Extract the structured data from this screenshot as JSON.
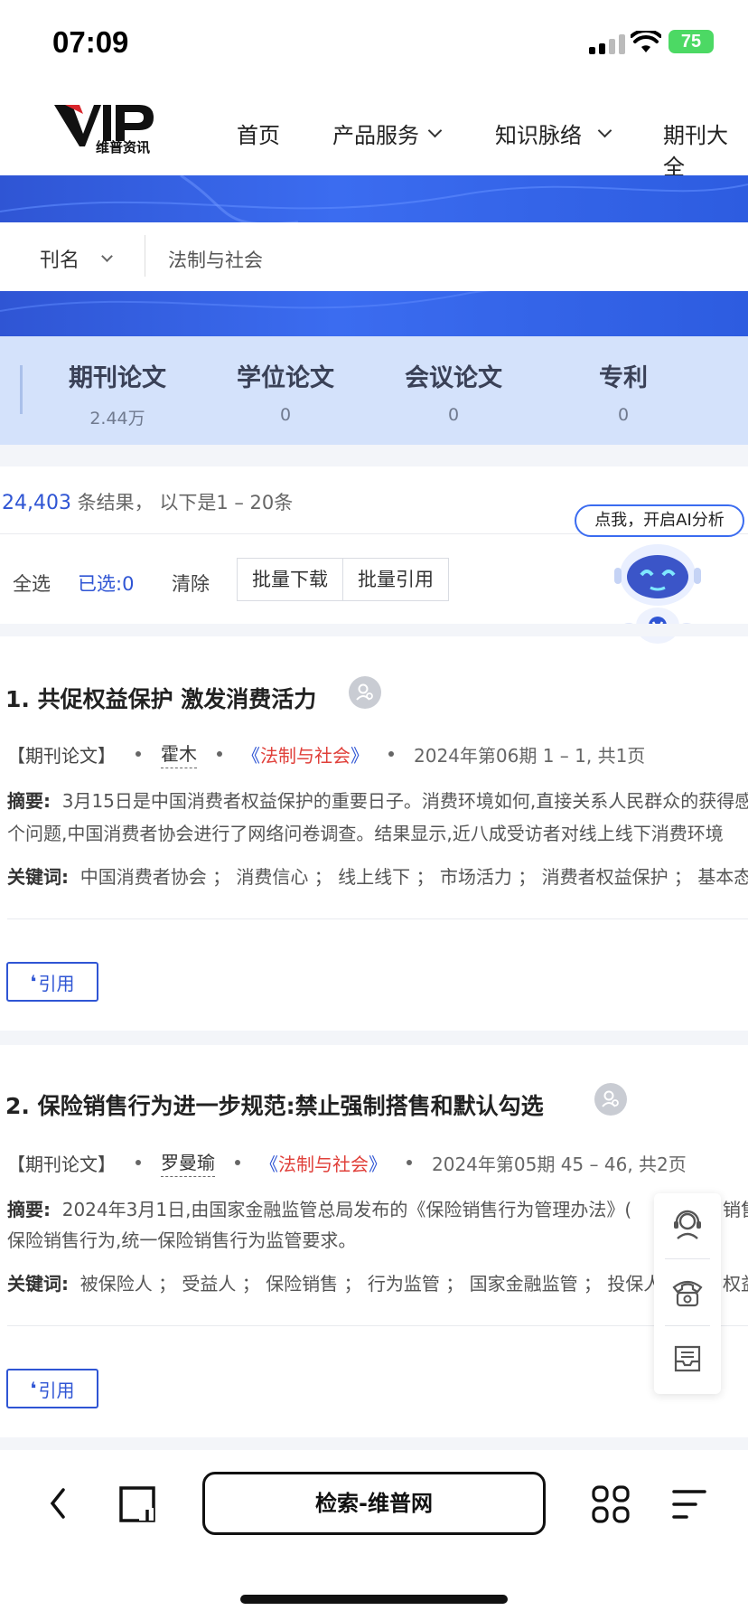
{
  "status_bar": {
    "time": "07:09",
    "battery": "75"
  },
  "nav": {
    "logo_text": "维普资讯",
    "items": [
      "首页",
      "产品服务",
      "知识脉络",
      "期刊大全"
    ]
  },
  "search": {
    "type_label": "刊名",
    "value": "法制与社会"
  },
  "tabs": [
    {
      "title": "期刊论文",
      "count": "2.44万"
    },
    {
      "title": "学位论文",
      "count": "0"
    },
    {
      "title": "会议论文",
      "count": "0"
    },
    {
      "title": "专利",
      "count": "0"
    }
  ],
  "results": {
    "count": "24,403",
    "suffix": "条结果， 以下是1 – 20条"
  },
  "toolbar": {
    "select_all": "全选",
    "selected": "已选:0",
    "clear": "清除",
    "batch_download": "批量下载",
    "batch_cite": "批量引用"
  },
  "ai": {
    "bubble": "点我，开启AI分析"
  },
  "articles": [
    {
      "title": "1. 共促权益保护 激发消费活力",
      "type": "【期刊论文】",
      "author": "霍木",
      "journal_open": "《",
      "journal": "法制与社会",
      "journal_close": "》",
      "issue": "2024年第06期 1 – 1,  共1页",
      "abstract_label": "摘要:",
      "abstract_1": "3月15日是中国消费者权益保护的重要日子。消费环境如何,直接关系人民群众的获得感",
      "abstract_2": "个问题,中国消费者协会进行了网络问卷调查。结果显示,近八成受访者对线上线下消费环境",
      "keywords_label": "关键词:",
      "keywords": "中国消费者协会 ； 消费信心 ； 线上线下 ； 市场活力 ； 消费者权益保护 ； 基本态",
      "cite": "引用"
    },
    {
      "title": "2. 保险销售行为进一步规范:禁止强制搭售和默认勾选",
      "type": "【期刊论文】",
      "author": "罗曼瑜",
      "journal_open": "《",
      "journal": "法制与社会",
      "journal_close": "》",
      "issue": "2024年第05期 45 – 46,  共2页",
      "abstract_label": "摘要:",
      "abstract_1": "2024年3月1日,由国家金融监管总局发布的《保险销售行为管理办法》(",
      "abstract_1_tail": "销售",
      "abstract_2": "保险销售行为,统一保险销售行为监管要求。",
      "keywords_label": "关键词:",
      "keywords": "被保险人 ； 受益人 ； 保险销售 ； 行为监管 ； 国家金融监管 ； 投保人",
      "keywords_tail": "权益",
      "cite": "引用"
    }
  ],
  "browser": {
    "address": "检索-维普网"
  },
  "colors": {
    "brand_blue": "#2f55d4",
    "journal_red": "#e0403a",
    "tab_bg": "#d4e2fb"
  }
}
